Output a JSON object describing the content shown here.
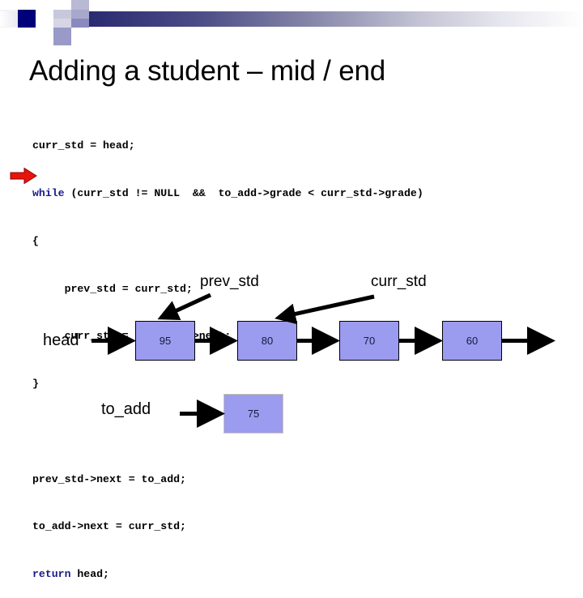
{
  "slide": {
    "title": "Adding a student – mid / end"
  },
  "code": {
    "lines": [
      {
        "text": "curr_std = head;",
        "keyword": ""
      },
      {
        "text": "while (curr_std != NULL  &&  to_add->grade < curr_std->grade)",
        "keyword": "while"
      },
      {
        "text": "{",
        "keyword": ""
      },
      {
        "text": "     prev_std = curr_std;",
        "keyword": ""
      },
      {
        "text": "     curr_std = curr_std->next;",
        "keyword": ""
      },
      {
        "text": "}",
        "keyword": ""
      },
      {
        "text": "",
        "keyword": ""
      },
      {
        "text": "prev_std->next = to_add;",
        "keyword": ""
      },
      {
        "text": "to_add->next = curr_std;",
        "keyword": ""
      },
      {
        "text": "return head;",
        "keyword": "return"
      }
    ],
    "keyword_color": "#1a1a8c",
    "text_color": "#000000"
  },
  "marker": {
    "name": "red-arrow",
    "color": "#e8140c"
  },
  "diagram": {
    "node_fill": "#9b9bf0",
    "node_border": "#000000",
    "list_nodes": [
      {
        "value": "95"
      },
      {
        "value": "80"
      },
      {
        "value": "70"
      },
      {
        "value": "60"
      }
    ],
    "new_node": {
      "value": "75"
    },
    "labels": {
      "head": "head",
      "to_add": "to_add",
      "prev_std": "prev_std",
      "curr_std": "curr_std"
    }
  }
}
